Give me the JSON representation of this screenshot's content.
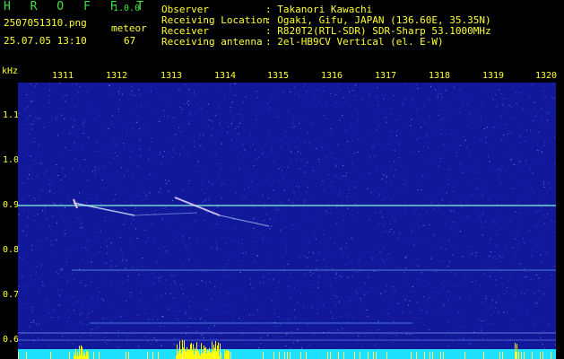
{
  "header": {
    "app_name": "H R O F F T",
    "version": "1.0.0",
    "filename": "2507051310.png",
    "datetime": "25.07.05 13:10",
    "detection_label": "meteor",
    "detection_count": "67",
    "info_labels": [
      "Observer",
      "Receiving Location",
      "Receiver",
      "Receiving antenna"
    ],
    "info_values": [
      ": Takanori Kawachi",
      ": Ogaki, Gifu, JAPAN (136.60E, 35.35N)",
      ": R820T2(RTL-SDR) SDR-Sharp 53.1000MHz",
      ": 2el-HB9CV Vertical (el. E-W)"
    ]
  },
  "axis": {
    "y_unit": "kHz",
    "y_ticks": [
      "1.1",
      "1.0",
      "0.9",
      "0.8",
      "0.7",
      "0.6"
    ],
    "y_tick_values": [
      1.1,
      1.0,
      0.9,
      0.8,
      0.7,
      0.6
    ],
    "x_ticks": [
      "1311",
      "1312",
      "1313",
      "1314",
      "1315",
      "1316",
      "1317",
      "1318",
      "1319",
      "1320"
    ]
  },
  "colors": {
    "background": "#12189a",
    "axis_text": "#ffff33",
    "title_green": "#3fe03f",
    "trace": "#b8e8ff",
    "intensity_bar": "#ffff00"
  }
}
